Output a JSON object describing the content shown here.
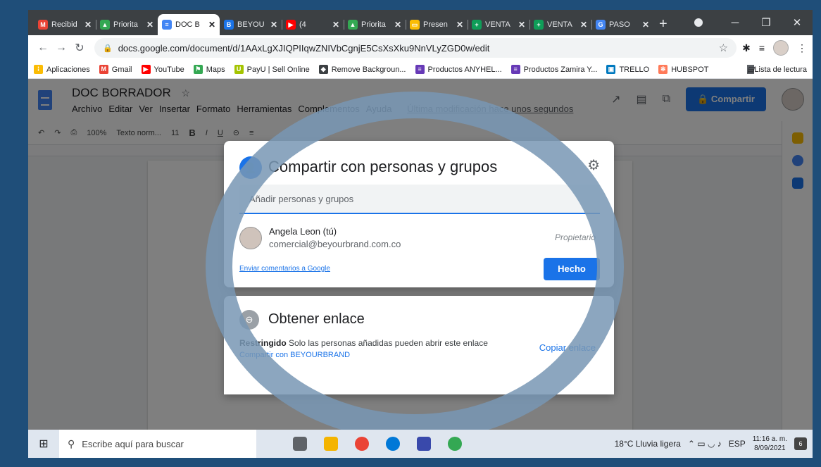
{
  "browser": {
    "tabs": [
      {
        "title": "Recibid",
        "color": "#ea4335",
        "glyph": "M",
        "active": false
      },
      {
        "title": "Priorita",
        "color": "#34a853",
        "glyph": "▲",
        "active": false
      },
      {
        "title": "DOC B",
        "color": "#4285f4",
        "glyph": "≡",
        "active": true
      },
      {
        "title": "BEYOU",
        "color": "#1a73e8",
        "glyph": "B",
        "active": false
      },
      {
        "title": "(4",
        "color": "#ff0000",
        "glyph": "▶",
        "active": false
      },
      {
        "title": "Priorita",
        "color": "#34a853",
        "glyph": "▲",
        "active": false
      },
      {
        "title": "Presen",
        "color": "#fbbc04",
        "glyph": "▭",
        "active": false
      },
      {
        "title": "VENTA",
        "color": "#0f9d58",
        "glyph": "+",
        "active": false
      },
      {
        "title": "VENTA",
        "color": "#0f9d58",
        "glyph": "+",
        "active": false
      },
      {
        "title": "PASO",
        "color": "#4285f4",
        "glyph": "G",
        "active": false
      }
    ],
    "new_tab": "+",
    "url": "docs.google.com/document/d/1AAxLgXJIQPIIqwZNIVbCgnjE5CsXsXku9NnVLyZGD0w/edit",
    "bookmarks": [
      {
        "label": "Aplicaciones",
        "color": "#fbbc04",
        "glyph": "⁞"
      },
      {
        "label": "Gmail",
        "color": "#ea4335",
        "glyph": "M"
      },
      {
        "label": "YouTube",
        "color": "#ff0000",
        "glyph": "▶"
      },
      {
        "label": "Maps",
        "color": "#34a853",
        "glyph": "⚑"
      },
      {
        "label": "PayU | Sell Online",
        "color": "#a4c400",
        "glyph": "U"
      },
      {
        "label": "Remove Backgroun...",
        "color": "#3c4043",
        "glyph": "◆"
      },
      {
        "label": "Productos ANYHEL...",
        "color": "#673ab7",
        "glyph": "≡"
      },
      {
        "label": "Productos Zamira Y...",
        "color": "#673ab7",
        "glyph": "≡"
      },
      {
        "label": "TRELLO",
        "color": "#0079bf",
        "glyph": "▣"
      },
      {
        "label": "HUBSPOT",
        "color": "#ff7a59",
        "glyph": "✻"
      }
    ],
    "reading_list": "Lista de lectura"
  },
  "docs": {
    "title": "DOC BORRADOR",
    "menu": [
      "Archivo",
      "Editar",
      "Ver",
      "Insertar",
      "Formato",
      "Herramientas",
      "Complementos",
      "Ayuda"
    ],
    "last_edit": "Última modificación hace unos segundos",
    "share_label": "Compartir",
    "toolbar": {
      "zoom": "100%",
      "style": "Texto norm...",
      "font_size": "11"
    }
  },
  "share_dialog": {
    "title": "Compartir con personas y grupos",
    "input_placeholder": "Añadir personas y grupos",
    "person_name": "Angela Leon (tú)",
    "person_email": "comercial@beyourbrand.com.co",
    "person_role": "Propietario",
    "feedback_link": "Enviar comentarios a Google",
    "done_label": "Hecho"
  },
  "link_dialog": {
    "title": "Obtener enlace",
    "restriction": "Restringido",
    "description": "Solo las personas añadidas pueden abrir este enlace",
    "share_org": "Compartir con BEYOURBRAND",
    "copy_label": "Copiar enlace"
  },
  "taskbar": {
    "search_placeholder": "Escribe aquí para buscar",
    "weather": "18°C  Lluvia ligera",
    "language": "ESP",
    "time": "11:16 a. m.",
    "date": "8/09/2021",
    "notifications": "6"
  }
}
